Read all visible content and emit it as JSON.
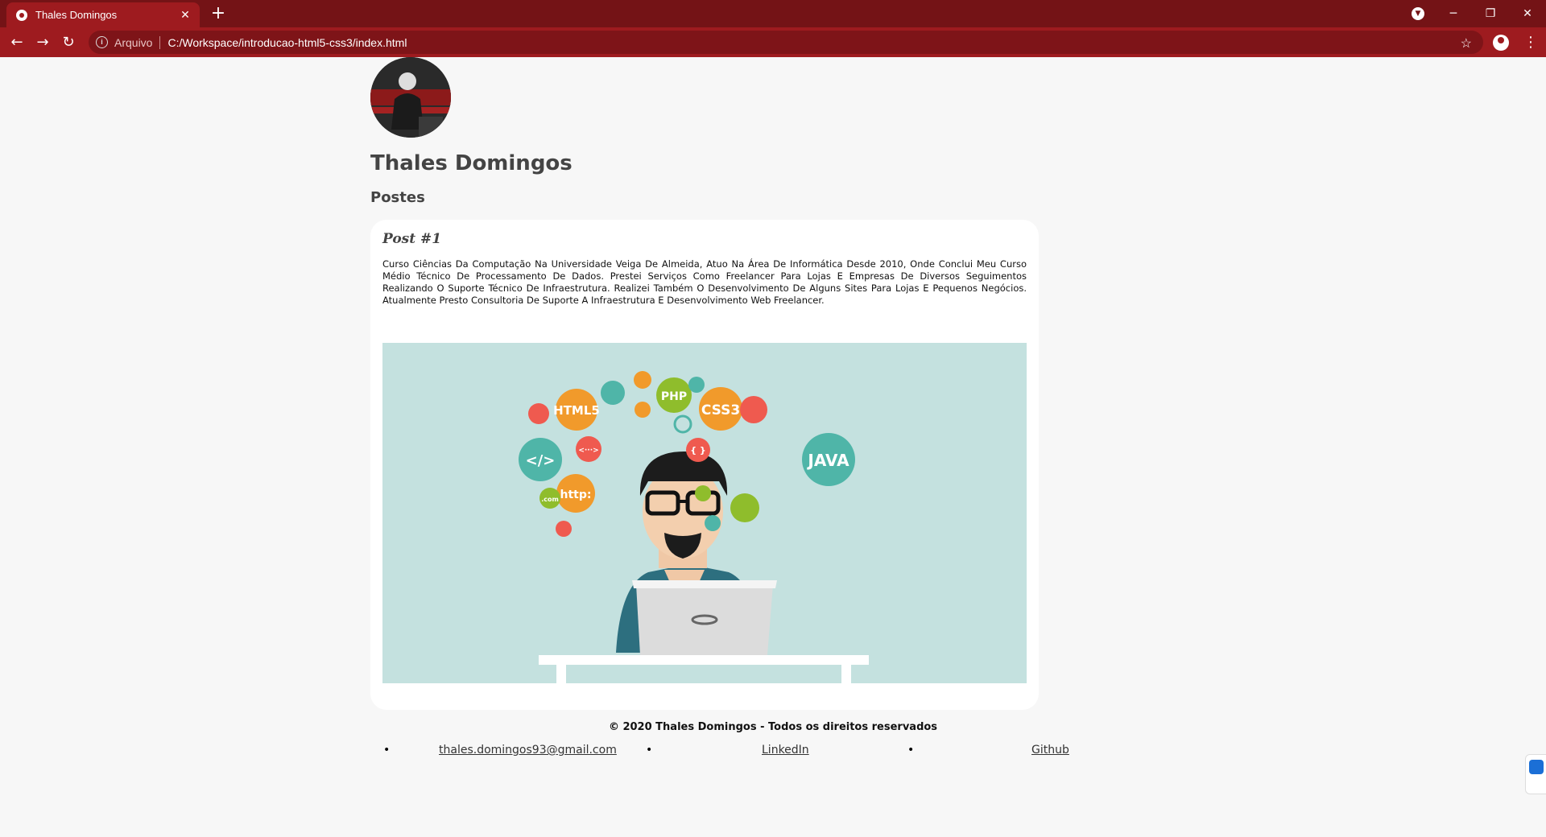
{
  "browser": {
    "tab_title": "Thales Domingos",
    "address_scheme": "Arquivo",
    "address_url": "C:/Workspace/introducao-html5-css3/index.html"
  },
  "page": {
    "name": "Thales Domingos",
    "section_title": "Postes",
    "post": {
      "title": "Post #1",
      "text": "Curso Ciências Da Computação Na Universidade Veiga De Almeida, Atuo Na Área De Informática Desde 2010, Onde Conclui Meu Curso Médio Técnico De Processamento De Dados. Prestei Serviços Como Freelancer Para Lojas E Empresas De Diversos Seguimentos Realizando O Suporte Técnico De Infraestrutura. Realizei Também O Desenvolvimento De Alguns Sites Para Lojas E Pequenos Negócios. Atualmente Presto Consultoria De Suporte A Infraestrutura E Desenvolvimento Web Freelancer."
    },
    "illustration_labels": {
      "html5": "HTML5",
      "php": "PHP",
      "css3": "CSS3",
      "java": "JAVA",
      "http": "http:",
      "com": ".com",
      "code": "</>",
      "tag": "<···>",
      "braces": "{ }"
    },
    "footer": {
      "copyright": "© 2020 Thales Domingos - Todos os direitos reservados",
      "links": [
        "thales.domingos93@gmail.com",
        "LinkedIn",
        "Github"
      ]
    }
  },
  "colors": {
    "tabbar": "#741316",
    "toolbar": "#9e1b1f",
    "page_bg": "#f7f7f7",
    "illustration_bg": "#c4e1df"
  }
}
